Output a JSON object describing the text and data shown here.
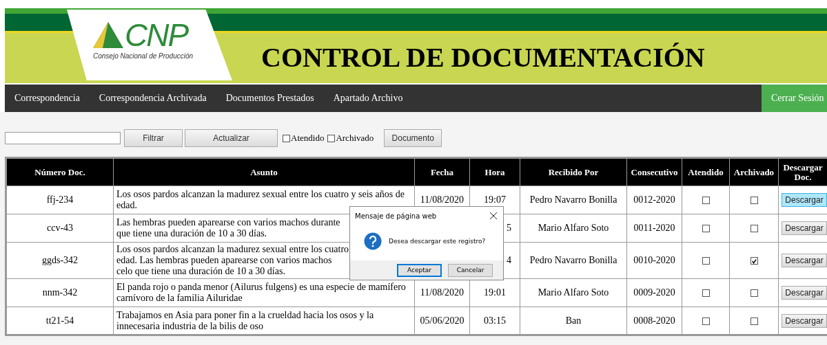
{
  "header": {
    "logo_mark": "CNP",
    "logo_subtitle": "Consejo Nacional de Producción",
    "title": "CONTROL DE DOCUMENTACIÓN"
  },
  "nav": {
    "items": [
      {
        "label": "Correspondencia"
      },
      {
        "label": "Correspondencia Archivada"
      },
      {
        "label": "Documentos Prestados"
      },
      {
        "label": "Apartado Archivo"
      }
    ],
    "logout": "Cerrar Sesión"
  },
  "toolbar": {
    "filter_button": "Filtrar",
    "refresh_button": "Actualizar",
    "checkboxes": [
      {
        "label": "Atendido",
        "checked": false
      },
      {
        "label": "Archivado",
        "checked": false
      }
    ],
    "document_button": "Documento"
  },
  "table": {
    "columns": [
      "Número Doc.",
      "Asunto",
      "Fecha",
      "Hora",
      "Recibido Por",
      "Consecutivo",
      "Atendido",
      "Archivado",
      "Descargar Doc."
    ],
    "rows": [
      {
        "numero": "ffj-234",
        "asunto": [
          "Los osos pardos alcanzan la madurez sexual entre los cuatro y seis años de",
          "edad."
        ],
        "fecha": "11/08/2020",
        "hora": "19:07",
        "covered": false,
        "recibido": "Pedro Navarro Bonilla",
        "consecutivo": "0012-2020",
        "atendido": false,
        "archivado": false,
        "button": "Descargar",
        "highlighted": true
      },
      {
        "numero": "ccv-43",
        "asunto": [
          "Las hembras pueden aparearse con varios machos durante",
          "que tiene una duración de 10 a 30 días."
        ],
        "hora": "5",
        "covered": true,
        "recibido": "Mario Alfaro Soto",
        "consecutivo": "0011-2020",
        "atendido": false,
        "archivado": false,
        "button": "Descargar",
        "highlighted": false
      },
      {
        "numero": "ggds-342",
        "asunto": [
          "Los osos pardos alcanzan la madurez sexual entre los cuatro",
          "edad. Las hembras pueden aparearse con varios machos",
          "celo que tiene una duración de 10 a 30 días."
        ],
        "hora": "4",
        "covered": true,
        "recibido": "Pedro Navarro Bonilla",
        "consecutivo": "0010-2020",
        "atendido": false,
        "archivado": true,
        "button": "Descargar",
        "highlighted": false
      },
      {
        "numero": "nnm-342",
        "asunto": [
          "El panda rojo o panda menor (Ailurus fulgens) es una especie de mamífero",
          "carnívoro de la familia Ailuridae"
        ],
        "fecha": "11/08/2020",
        "hora": "19:01",
        "covered": false,
        "recibido": "Mario Alfaro Soto",
        "consecutivo": "0009-2020",
        "atendido": false,
        "archivado": false,
        "button": "Descargar",
        "highlighted": false
      },
      {
        "numero": "tt21-54",
        "asunto": [
          "Trabajamos en Asia para poner fin a la crueldad hacia los osos y la",
          "innecesaria industria de la bilis de oso"
        ],
        "fecha": "05/06/2020",
        "hora": "03:15",
        "covered": false,
        "recibido": "Ban",
        "consecutivo": "0008-2020",
        "atendido": false,
        "archivado": false,
        "button": "Descargar",
        "highlighted": false
      }
    ]
  },
  "dialog": {
    "title": "Mensaje de página web",
    "message": "Desea descargar este registro?",
    "buttons": [
      {
        "label": "Aceptar",
        "selected": true
      },
      {
        "label": "Cancelar",
        "selected": false
      }
    ]
  }
}
